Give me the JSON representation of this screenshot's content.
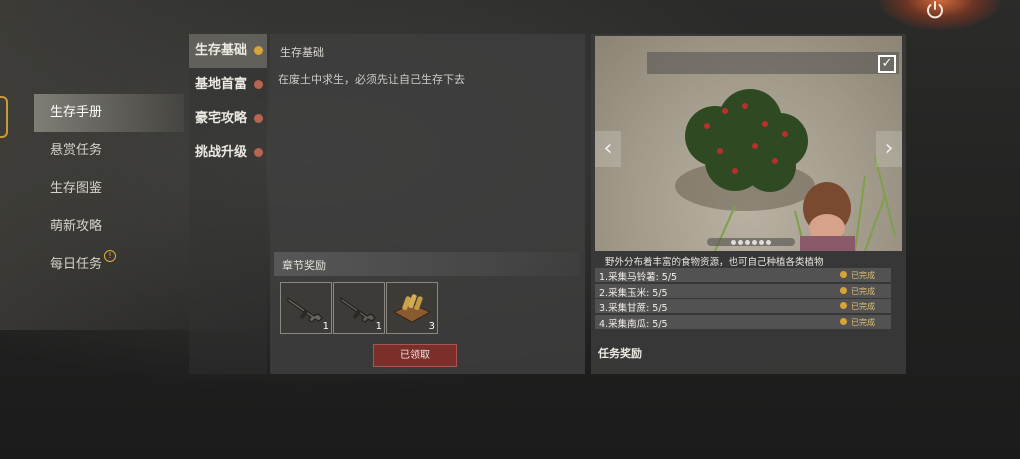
{
  "main_nav": {
    "items": [
      {
        "label": "生存手册",
        "active": true
      },
      {
        "label": "悬赏任务"
      },
      {
        "label": "生存图鉴"
      },
      {
        "label": "萌新攻略"
      },
      {
        "label": "每日任务",
        "alert": true
      }
    ]
  },
  "sub_nav": {
    "items": [
      {
        "label": "生存基础",
        "active": true,
        "done": true
      },
      {
        "label": "基地首富"
      },
      {
        "label": "豪宅攻略"
      },
      {
        "label": "挑战升级"
      }
    ]
  },
  "content": {
    "title": "生存基础",
    "description": "在废土中求生，必须先让自己生存下去",
    "chapter_reward_label": "章节奖励",
    "rewards": [
      {
        "icon": "rifle-icon",
        "qty": "1"
      },
      {
        "icon": "rifle-icon",
        "qty": "1"
      },
      {
        "icon": "ammo-crate-icon",
        "qty": "3"
      }
    ],
    "claimed_label": "已领取"
  },
  "preview": {
    "scene_description": "野外分布着丰富的食物资源，也可自己种植各类植物",
    "tasks": [
      {
        "label": "1.采集马铃薯: 5/5",
        "status": "已完成"
      },
      {
        "label": "2.采集玉米: 5/5",
        "status": "已完成"
      },
      {
        "label": "3.采集甘蔗: 5/5",
        "status": "已完成"
      },
      {
        "label": "4.采集南瓜: 5/5",
        "status": "已完成"
      }
    ],
    "task_reward_label": "任务奖励"
  },
  "colors": {
    "accent_gold": "#d7a43a",
    "claimed_red": "#7a2f2a",
    "incomplete_dot": "#b8654f"
  }
}
